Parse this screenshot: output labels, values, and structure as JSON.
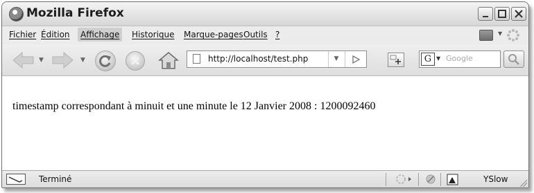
{
  "window": {
    "title": "Mozilla Firefox"
  },
  "menubar": {
    "items": [
      "Fichier",
      "Édition",
      "Affichage",
      "Historique",
      "Marque-pages",
      "Outils",
      "?"
    ],
    "active": "Affichage"
  },
  "toolbar": {
    "url": "http://localhost/test.php",
    "search_placeholder": "Google",
    "search_engine_letter": "G"
  },
  "content": {
    "text": "timestamp correspondant à minuit et une minute le 12 Janvier 2008 : 1200092460"
  },
  "statusbar": {
    "status": "Terminé",
    "yslow": "YSlow"
  },
  "icons": {
    "back": "back-arrow-icon",
    "forward": "forward-arrow-icon",
    "reload": "reload-icon",
    "stop": "stop-icon",
    "home": "home-icon"
  }
}
